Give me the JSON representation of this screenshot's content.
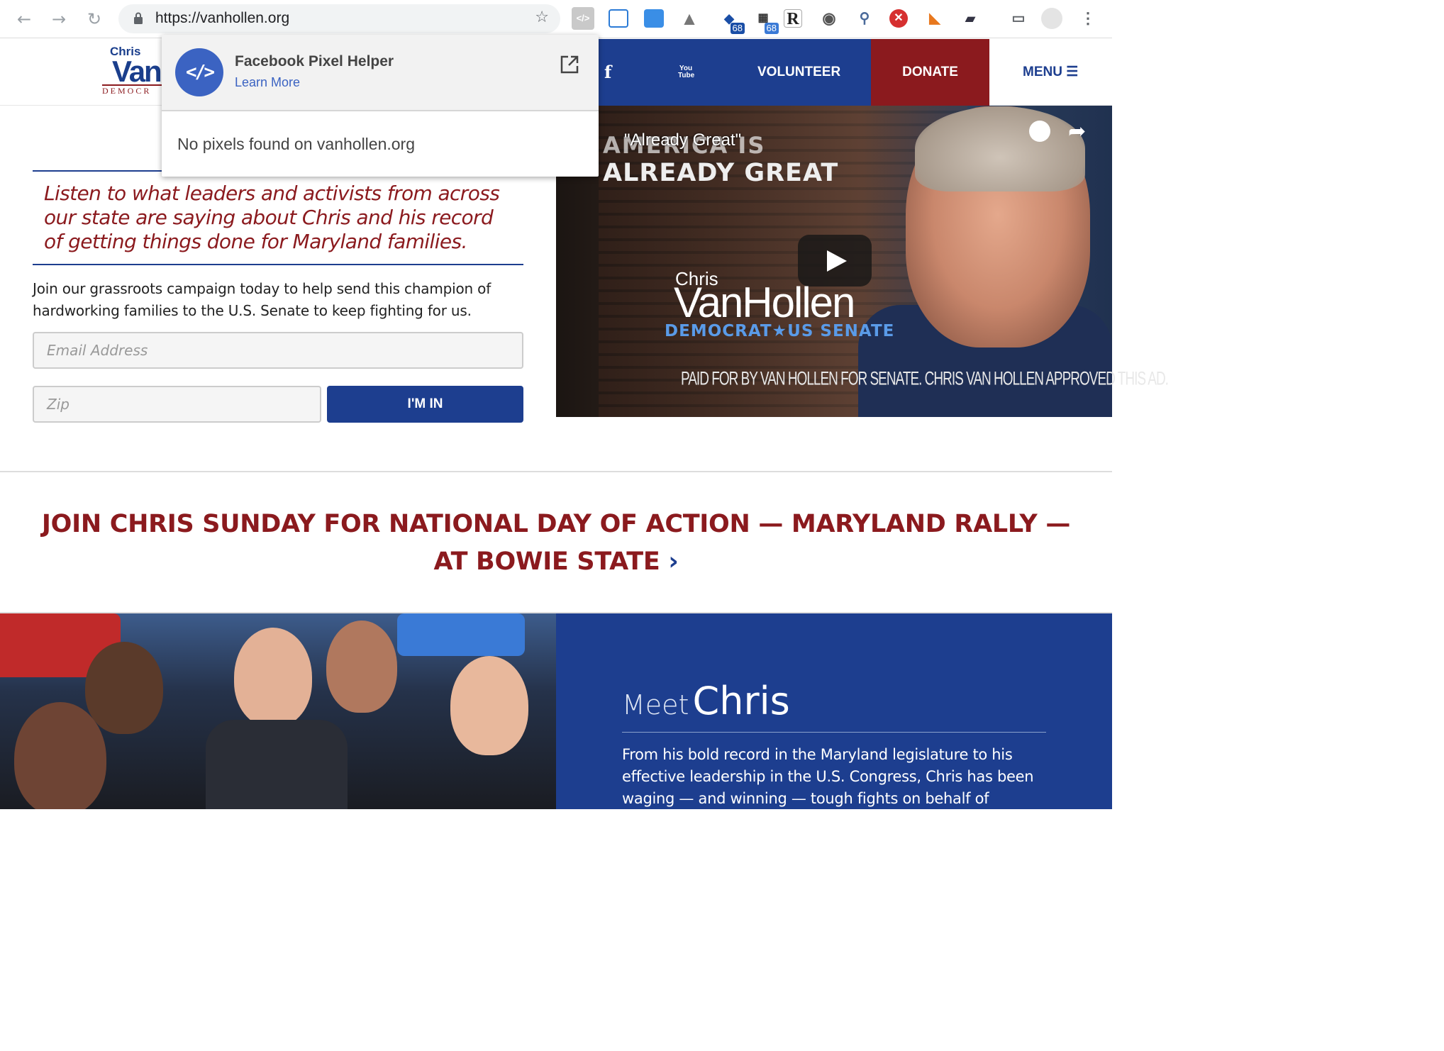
{
  "browser": {
    "url": "https://vanhollen.org",
    "extension_badges": [
      "68",
      "68"
    ]
  },
  "site_nav": {
    "logo_chris": "Chris",
    "logo_van": "Van",
    "logo_democrat": "DEMOCR",
    "facebook_icon": "f",
    "youtube_icon": "You Tube",
    "volunteer": "VOLUNTEER",
    "donate": "DONATE",
    "menu": "MENU"
  },
  "popup": {
    "title": "Facebook Pixel Helper",
    "learn_more": "Learn More",
    "message": "No pixels found on vanhollen.org",
    "icon": "</>"
  },
  "signup": {
    "quote": "Listen to what leaders and activists from across our state are saying about Chris and his record of getting things done for Maryland families.",
    "intro": "Join our grassroots campaign today to help send this champion of hardworking families to the U.S. Senate to keep fighting for us.",
    "email_placeholder": "Email Address",
    "zip_placeholder": "Zip",
    "submit": "I'M IN"
  },
  "video": {
    "title": "\"Already Great\"",
    "headline_1": "AMERICA IS",
    "headline_2": "ALREADY GREAT",
    "brand_chris": "Chris",
    "brand_name": "VanHollen",
    "brand_sub": "DEMOCRAT★US SENATE",
    "paid_for": "PAID FOR BY VAN HOLLEN FOR SENATE. CHRIS VAN HOLLEN APPROVED THIS AD."
  },
  "banner": {
    "text": "JOIN CHRIS SUNDAY FOR NATIONAL DAY OF ACTION — MARYLAND RALLY — AT BOWIE STATE",
    "chevron": "›"
  },
  "meet": {
    "meet_word": "Meet",
    "name": "Chris",
    "body": "From his bold record in the Maryland legislature to his effective leadership in the U.S. Congress, Chris has been waging — and winning — tough fights on behalf of"
  },
  "colors": {
    "navy": "#1d3e8f",
    "maroon": "#8b1a1e"
  }
}
